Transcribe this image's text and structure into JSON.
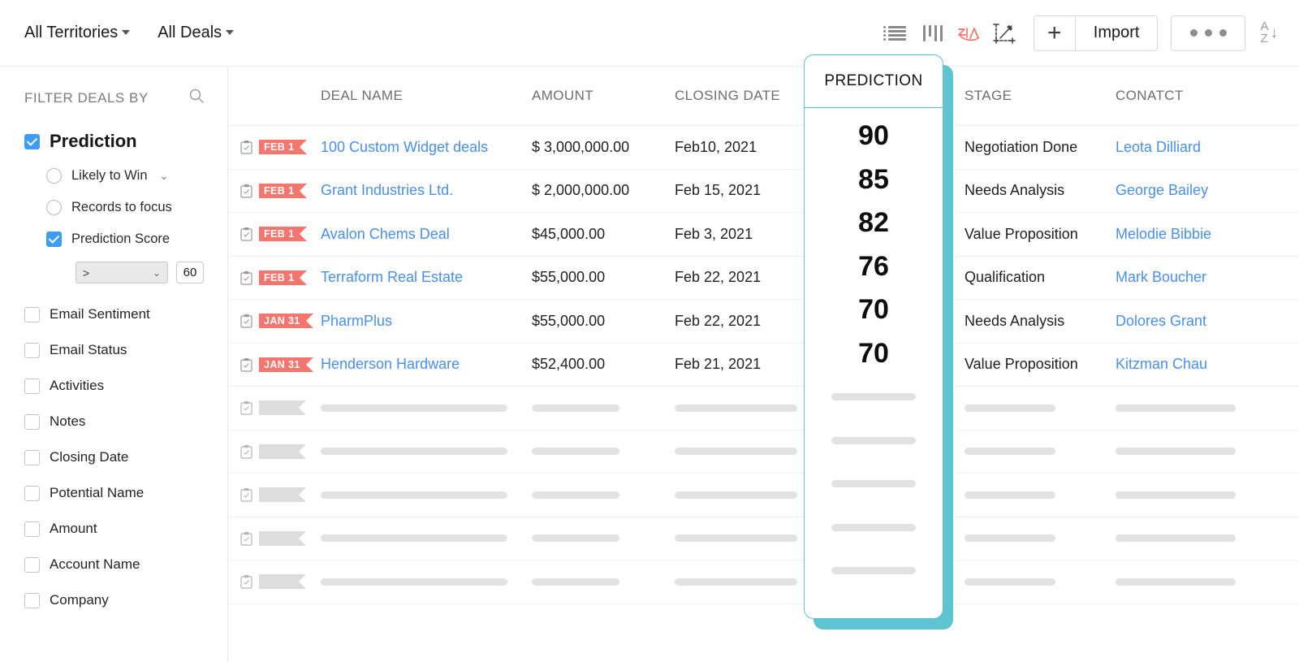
{
  "topbar": {
    "territories_label": "All Territories",
    "deals_label": "All Deals",
    "icons": {
      "list": "list-view-icon",
      "kanban": "kanban-view-icon",
      "zia": "zia-ai-icon",
      "chart": "chart-edit-icon",
      "sort": "sort-az-icon"
    },
    "zia_text": "Zia",
    "plus_label": "+",
    "import_label": "Import",
    "sort_a": "A",
    "sort_z": "Z",
    "sort_arrow": "↓"
  },
  "sidebar": {
    "header": "FILTER DEALS BY",
    "search_icon": "search-icon",
    "prediction": {
      "label": "Prediction",
      "checked": true,
      "options": [
        {
          "label": "Likely to Win",
          "type": "radio",
          "checked": false,
          "caret": "⌄"
        },
        {
          "label": "Records to focus",
          "type": "radio",
          "checked": false,
          "caret": ""
        },
        {
          "label": "Prediction Score",
          "type": "checkbox",
          "checked": true,
          "caret": ""
        }
      ],
      "condition": {
        "operator": ">",
        "operator_caret": "⌄",
        "value": "60"
      }
    },
    "filters": [
      {
        "label": "Email Sentiment",
        "checked": false
      },
      {
        "label": "Email Status",
        "checked": false
      },
      {
        "label": "Activities",
        "checked": false
      },
      {
        "label": "Notes",
        "checked": false
      },
      {
        "label": "Closing Date",
        "checked": false
      },
      {
        "label": "Potential Name",
        "checked": false
      },
      {
        "label": "Amount",
        "checked": false
      },
      {
        "label": "Account Name",
        "checked": false
      },
      {
        "label": "Company",
        "checked": false
      }
    ]
  },
  "table": {
    "columns": {
      "flag": "",
      "deal_name": "DEAL NAME",
      "amount": "AMOUNT",
      "closing_date": "CLOSING DATE",
      "prediction": "PREDICTION",
      "stage": "STAGE",
      "contact": "CONATCT"
    },
    "rows": [
      {
        "badge": "FEB 1",
        "deal_name": "100 Custom Widget deals",
        "amount": "$ 3,000,000.00",
        "closing_date": "Feb10, 2021",
        "prediction": "90",
        "stage": "Negotiation Done",
        "contact": "Leota Dilliard"
      },
      {
        "badge": "FEB 1",
        "deal_name": "Grant Industries Ltd.",
        "amount": "$ 2,000,000.00",
        "closing_date": "Feb 15, 2021",
        "prediction": "85",
        "stage": "Needs Analysis",
        "contact": "George Bailey"
      },
      {
        "badge": "FEB 1",
        "deal_name": "Avalon Chems Deal",
        "amount": "$45,000.00",
        "closing_date": "Feb 3, 2021",
        "prediction": "82",
        "stage": "Value Proposition",
        "contact": "Melodie Bibbie"
      },
      {
        "badge": "FEB 1",
        "deal_name": "Terraform Real Estate",
        "amount": "$55,000.00",
        "closing_date": "Feb 22, 2021",
        "prediction": "76",
        "stage": "Qualification",
        "contact": "Mark Boucher"
      },
      {
        "badge": "JAN 31",
        "deal_name": "PharmPlus",
        "amount": "$55,000.00",
        "closing_date": "Feb 22, 2021",
        "prediction": "70",
        "stage": "Needs Analysis",
        "contact": "Dolores Grant"
      },
      {
        "badge": "JAN 31",
        "deal_name": "Henderson Hardware",
        "amount": "$52,400.00",
        "closing_date": "Feb 21, 2021",
        "prediction": "70",
        "stage": "Value Proposition",
        "contact": "Kitzman Chau"
      }
    ],
    "skeleton_row_count": 5
  },
  "colors": {
    "accent_teal": "#5ec4d2",
    "badge_coral": "#f5766e",
    "link_blue": "#4a90e6",
    "checkbox_blue": "#3e9df0",
    "zia_red": "#f2766b",
    "skeleton_gray": "#e2e2e2"
  }
}
